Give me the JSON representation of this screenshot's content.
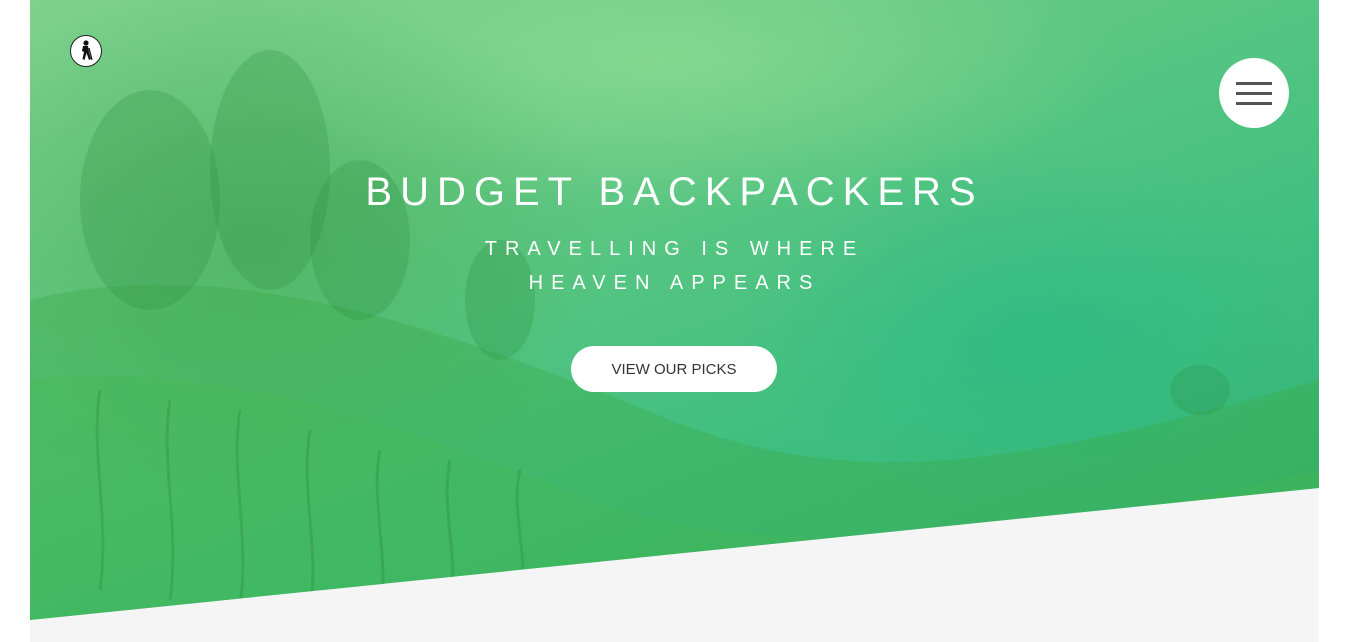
{
  "brand": {
    "logo_icon": "hiker-icon"
  },
  "header": {
    "menu_icon": "hamburger-menu-icon"
  },
  "hero": {
    "title": "BUDGET BACKPACKERS",
    "subtitle": "TRAVELLING IS WHERE HEAVEN APPEARS",
    "cta_label": "VIEW OUR PICKS"
  },
  "colors": {
    "hero_green": "#5fc783",
    "hero_teal": "#32b070",
    "page_background": "#f5f5f5",
    "button_background": "#ffffff",
    "button_text": "#333333"
  }
}
